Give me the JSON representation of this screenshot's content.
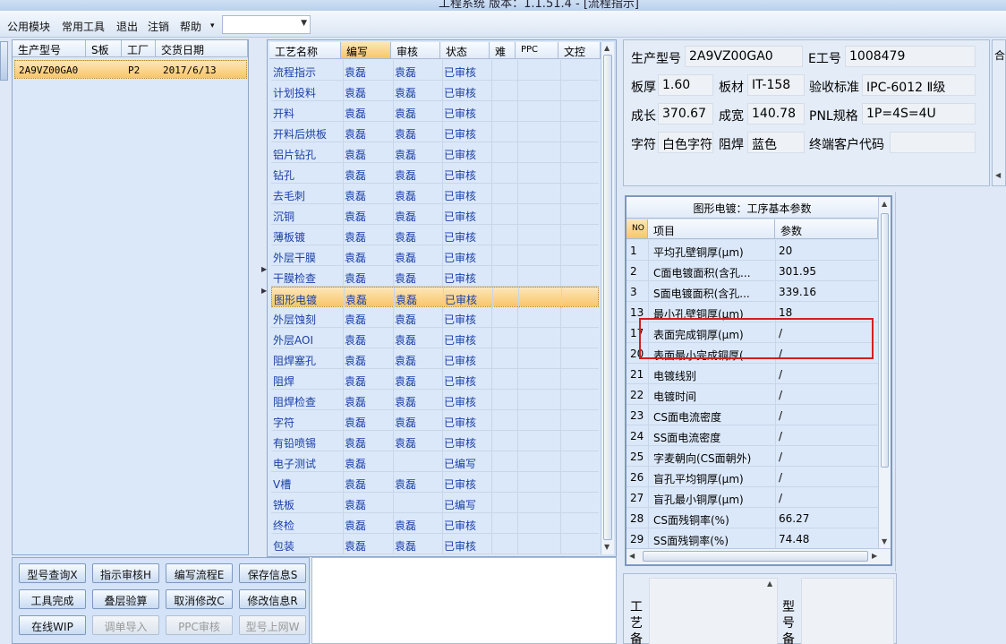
{
  "window_title": "工程系统  版本：1.1.51.4 - [流程指示]",
  "menu": [
    "公用模块",
    "常用工具",
    "退出",
    "注销",
    "帮助"
  ],
  "product_grid": {
    "headers": [
      "生产型号",
      "S板",
      "工厂",
      "交货日期"
    ],
    "row": {
      "model": "2A9VZ00GA0",
      "s": "",
      "factory": "P2",
      "date": "2017/6/13"
    }
  },
  "process_grid": {
    "headers": [
      "工艺名称",
      "编写",
      "审核",
      "状态",
      "难",
      "PPC",
      "文控"
    ],
    "rows": [
      {
        "name": "流程指示",
        "edit": "袁磊",
        "review": "袁磊",
        "status": "已审核"
      },
      {
        "name": "计划投料",
        "edit": "袁磊",
        "review": "袁磊",
        "status": "已审核"
      },
      {
        "name": "开料",
        "edit": "袁磊",
        "review": "袁磊",
        "status": "已审核"
      },
      {
        "name": "开料后烘板",
        "edit": "袁磊",
        "review": "袁磊",
        "status": "已审核"
      },
      {
        "name": "铝片钻孔",
        "edit": "袁磊",
        "review": "袁磊",
        "status": "已审核"
      },
      {
        "name": "钻孔",
        "edit": "袁磊",
        "review": "袁磊",
        "status": "已审核"
      },
      {
        "name": "去毛刺",
        "edit": "袁磊",
        "review": "袁磊",
        "status": "已审核"
      },
      {
        "name": "沉铜",
        "edit": "袁磊",
        "review": "袁磊",
        "status": "已审核"
      },
      {
        "name": "薄板镀",
        "edit": "袁磊",
        "review": "袁磊",
        "status": "已审核"
      },
      {
        "name": "外层干膜",
        "edit": "袁磊",
        "review": "袁磊",
        "status": "已审核"
      },
      {
        "name": "干膜检查",
        "edit": "袁磊",
        "review": "袁磊",
        "status": "已审核"
      },
      {
        "name": "图形电镀",
        "edit": "袁磊",
        "review": "袁磊",
        "status": "已审核"
      },
      {
        "name": "外层蚀刻",
        "edit": "袁磊",
        "review": "袁磊",
        "status": "已审核"
      },
      {
        "name": "外层AOI",
        "edit": "袁磊",
        "review": "袁磊",
        "status": "已审核"
      },
      {
        "name": "阻焊塞孔",
        "edit": "袁磊",
        "review": "袁磊",
        "status": "已审核"
      },
      {
        "name": "阻焊",
        "edit": "袁磊",
        "review": "袁磊",
        "status": "已审核"
      },
      {
        "name": "阻焊检查",
        "edit": "袁磊",
        "review": "袁磊",
        "status": "已审核"
      },
      {
        "name": "字符",
        "edit": "袁磊",
        "review": "袁磊",
        "status": "已审核"
      },
      {
        "name": "有铅喷锡",
        "edit": "袁磊",
        "review": "袁磊",
        "status": "已审核"
      },
      {
        "name": "电子测试",
        "edit": "袁磊",
        "review": "",
        "status": "已编写"
      },
      {
        "name": "V槽",
        "edit": "袁磊",
        "review": "袁磊",
        "status": "已审核"
      },
      {
        "name": "铣板",
        "edit": "袁磊",
        "review": "",
        "status": "已编写"
      },
      {
        "name": "终检",
        "edit": "袁磊",
        "review": "袁磊",
        "status": "已审核"
      },
      {
        "name": "包装",
        "edit": "袁磊",
        "review": "袁磊",
        "status": "已审核"
      }
    ],
    "selected_index": 11
  },
  "info": {
    "model_label": "生产型号",
    "model_value": "2A9VZ00GA0",
    "e_label": "E工号",
    "e_value": "1008479",
    "thick_label": "板厚",
    "thick_value": "1.60",
    "material_label": "板材",
    "material_value": "IT-158",
    "std_label": "验收标准",
    "std_value": "IPC-6012 Ⅱ级",
    "len_label": "成长",
    "len_value": "370.67",
    "width_label": "成宽",
    "width_value": "140.78",
    "pnl_label": "PNL规格",
    "pnl_value": "1P=4S=4U",
    "char_label": "字符",
    "char_value": "白色字符",
    "mask_label": "阻焊",
    "mask_value": "蓝色",
    "cust_label": "终端客户代码",
    "cust_value": "",
    "right_label": "合"
  },
  "params": {
    "title": "图形电镀：工序基本参数",
    "headers": [
      "NO",
      "项目",
      "参数"
    ],
    "rows": [
      {
        "no": "1",
        "item": "平均孔壁铜厚(μm)",
        "val": "20"
      },
      {
        "no": "2",
        "item": "C面电镀面积(含孔...",
        "val": "301.95"
      },
      {
        "no": "3",
        "item": "S面电镀面积(含孔...",
        "val": "339.16"
      },
      {
        "no": "13",
        "item": "最小孔壁铜厚(μm)",
        "val": "18"
      },
      {
        "no": "17",
        "item": "表面完成铜厚(μm)",
        "val": "/"
      },
      {
        "no": "20",
        "item": "表面最小完成铜厚(...",
        "val": "/"
      },
      {
        "no": "21",
        "item": "电镀线别",
        "val": "/"
      },
      {
        "no": "22",
        "item": "电镀时间",
        "val": "/"
      },
      {
        "no": "23",
        "item": "CS面电流密度",
        "val": "/"
      },
      {
        "no": "24",
        "item": "SS面电流密度",
        "val": "/"
      },
      {
        "no": "25",
        "item": "字麦朝向(CS面朝外)",
        "val": "/"
      },
      {
        "no": "26",
        "item": "盲孔平均铜厚(μm)",
        "val": "/"
      },
      {
        "no": "27",
        "item": "盲孔最小铜厚(μm)",
        "val": "/"
      },
      {
        "no": "28",
        "item": "CS面残铜率(%)",
        "val": "66.27"
      },
      {
        "no": "29",
        "item": "SS面残铜率(%)",
        "val": "74.48"
      }
    ]
  },
  "buttons": [
    {
      "label": "型号查询X",
      "disabled": false
    },
    {
      "label": "指示审核H",
      "disabled": false
    },
    {
      "label": "编写流程E",
      "disabled": false
    },
    {
      "label": "保存信息S",
      "disabled": false
    },
    {
      "label": "工具完成",
      "disabled": false
    },
    {
      "label": "叠层验算",
      "disabled": false
    },
    {
      "label": "取消修改C",
      "disabled": false
    },
    {
      "label": "修改信息R",
      "disabled": false
    },
    {
      "label": "在线WIP",
      "disabled": false
    },
    {
      "label": "调单导入",
      "disabled": true
    },
    {
      "label": "PPC审核",
      "disabled": true
    },
    {
      "label": "型号上网W",
      "disabled": true
    }
  ],
  "note": {
    "left_label": "工艺备",
    "right_label": "型号备"
  }
}
